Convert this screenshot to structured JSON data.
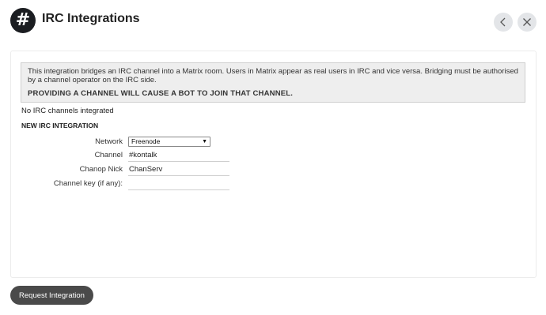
{
  "header": {
    "logo_glyph": "#",
    "title": "IRC Integrations"
  },
  "notice": {
    "text": "This integration bridges an IRC channel into a Matrix room. Users in Matrix appear as real users in IRC and vice versa. Bridging must be authorised by a channel operator on the IRC side.",
    "warning": "PROVIDING A CHANNEL WILL CAUSE A BOT TO JOIN THAT CHANNEL."
  },
  "status_text": "No IRC channels integrated",
  "form": {
    "section_title": "NEW IRC INTEGRATION",
    "network_label": "Network",
    "network_value": "Freenode",
    "channel_label": "Channel",
    "channel_value": "#kontalk",
    "chanop_label": "Chanop Nick",
    "chanop_value": "ChanServ",
    "key_label": "Channel key (if any):",
    "key_value": ""
  },
  "request_button": "Request Integration"
}
